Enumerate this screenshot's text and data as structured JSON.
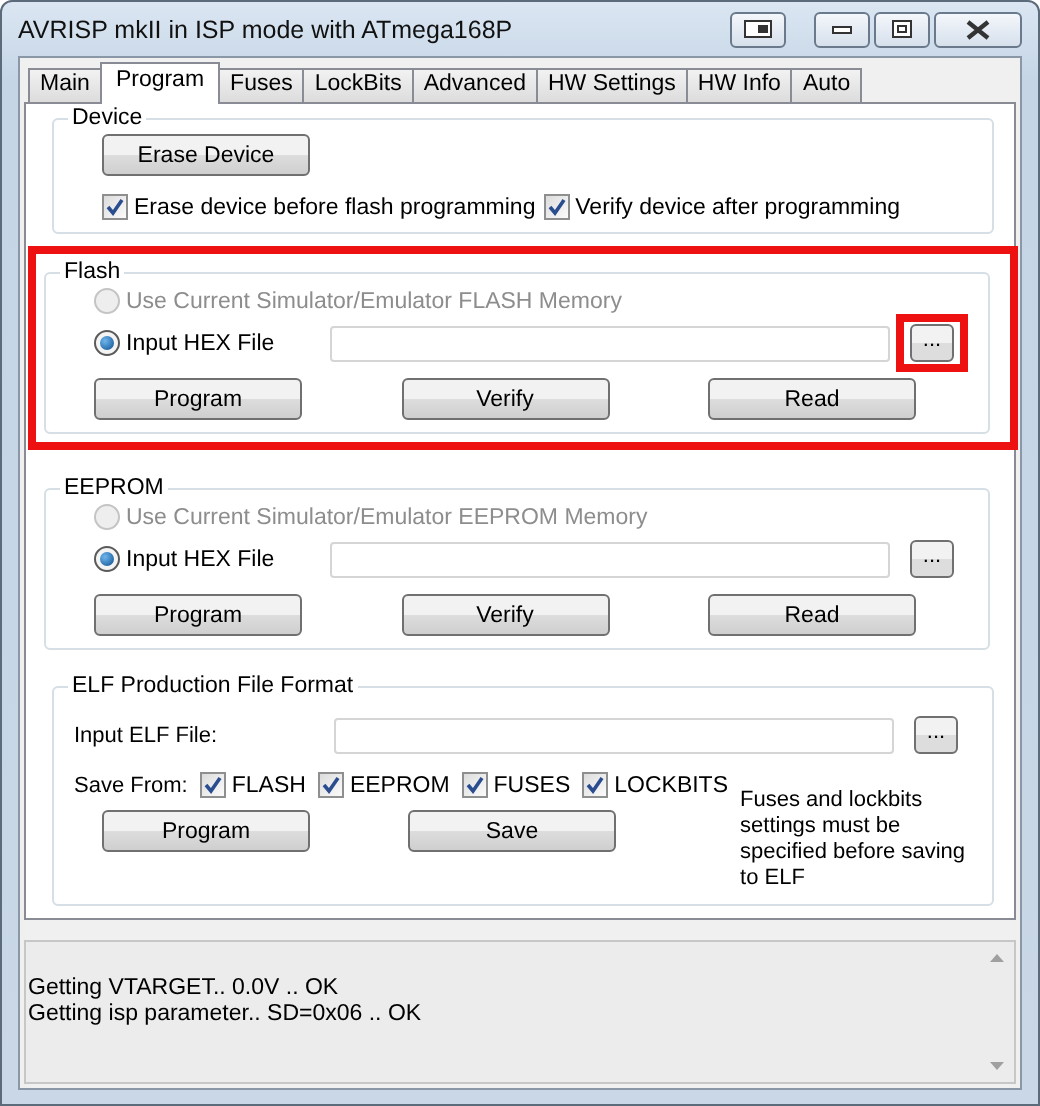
{
  "window": {
    "title": "AVRISP mkII in ISP mode with ATmega168P"
  },
  "tabs": [
    {
      "label": "Main",
      "selected": false
    },
    {
      "label": "Program",
      "selected": true
    },
    {
      "label": "Fuses",
      "selected": false
    },
    {
      "label": "LockBits",
      "selected": false
    },
    {
      "label": "Advanced",
      "selected": false
    },
    {
      "label": "HW Settings",
      "selected": false
    },
    {
      "label": "HW Info",
      "selected": false
    },
    {
      "label": "Auto",
      "selected": false
    }
  ],
  "device": {
    "title": "Device",
    "button": "Erase Device",
    "options": [
      {
        "label": "Erase device before flash programming",
        "checked": true
      },
      {
        "label": "Verify device after programming",
        "checked": true
      }
    ]
  },
  "memory_groups": [
    {
      "title": "Flash",
      "highlighted": true,
      "sources": [
        {
          "label": "Use Current Simulator/Emulator FLASH Memory",
          "selected": false,
          "disabled": true
        },
        {
          "label": "Input HEX File",
          "selected": true,
          "disabled": false
        }
      ],
      "browse": {
        "label": "...",
        "highlighted": true
      },
      "buttons": [
        "Program",
        "Verify",
        "Read"
      ]
    },
    {
      "title": "EEPROM",
      "highlighted": false,
      "sources": [
        {
          "label": "Use Current Simulator/Emulator EEPROM Memory",
          "selected": false,
          "disabled": true
        },
        {
          "label": "Input HEX File",
          "selected": true,
          "disabled": false
        }
      ],
      "browse": {
        "label": "...",
        "highlighted": false
      },
      "buttons": [
        "Program",
        "Verify",
        "Read"
      ]
    }
  ],
  "elf": {
    "title": "ELF Production File Format",
    "input_label": "Input ELF File:",
    "browse": "...",
    "save_from_label": "Save From:",
    "save_from": [
      {
        "label": "FLASH",
        "checked": true
      },
      {
        "label": "EEPROM",
        "checked": true
      },
      {
        "label": "FUSES",
        "checked": true
      },
      {
        "label": "LOCKBITS",
        "checked": true
      }
    ],
    "note": "Fuses and lockbits settings must be specified before saving to ELF",
    "buttons": [
      "Program",
      "Save"
    ]
  },
  "log": [
    "Getting VTARGET.. 0.0V .. OK",
    "Getting isp parameter.. SD=0x06 .. OK"
  ]
}
